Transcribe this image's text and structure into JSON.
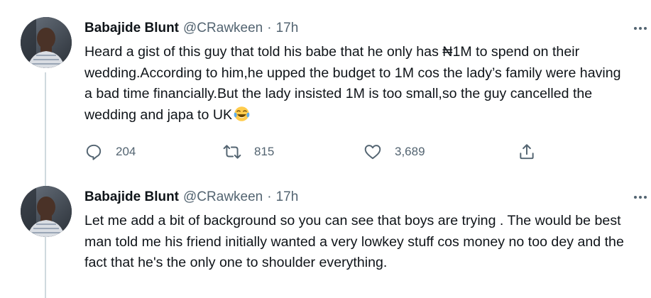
{
  "tweets": [
    {
      "author": {
        "name": "Babajide Blunt",
        "handle": "@CRawkeen",
        "avatar": "profile-photo"
      },
      "separator": "·",
      "time": "17h",
      "text": "Heard a gist of this guy that told his babe that he only has ₦1M to spend on their wedding.According to him,he upped the budget to 1M cos the lady’s family were having a bad time financially.But the lady insisted 1M is too small,so the guy cancelled the wedding and japa to UK",
      "emoji": "face-with-tears-of-joy",
      "stats": {
        "replies": "204",
        "retweets": "815",
        "likes": "3,689"
      },
      "icons": {
        "reply": "reply-icon",
        "retweet": "retweet-icon",
        "like": "heart-icon",
        "share": "share-icon",
        "more": "more-icon"
      }
    },
    {
      "author": {
        "name": "Babajide Blunt",
        "handle": "@CRawkeen",
        "avatar": "profile-photo"
      },
      "separator": "·",
      "time": "17h",
      "text": "Let me add a bit of background so you can see that boys are trying . The would be best man told me his friend initially wanted a very lowkey stuff cos money no too dey and the fact that he's the only one to shoulder everything."
    }
  ],
  "colors": {
    "text": "#0f1419",
    "secondary": "#536471",
    "thread_line": "#cfd9de"
  }
}
